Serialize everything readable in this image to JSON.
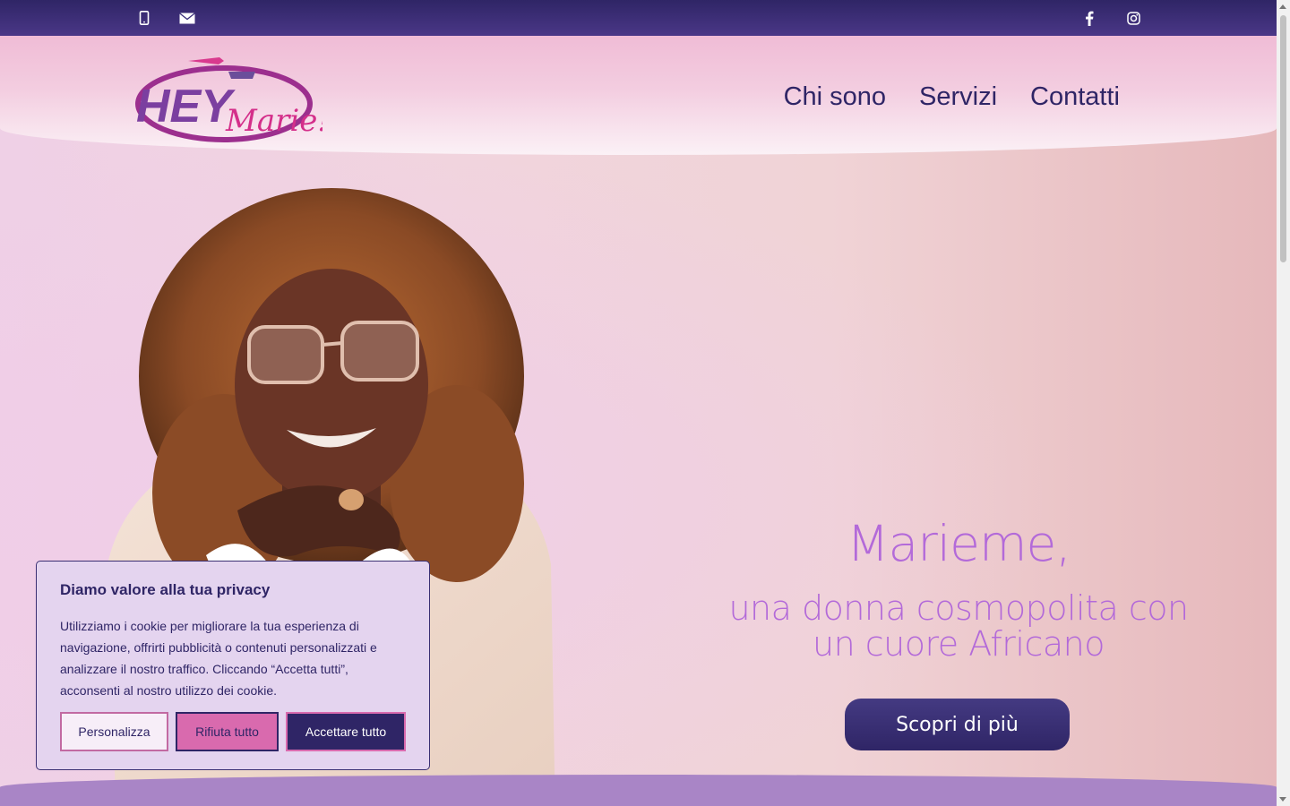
{
  "topbar": {
    "left_icons": [
      "mobile-phone-icon",
      "envelope-icon"
    ],
    "right_icons": [
      "facebook-icon",
      "instagram-icon"
    ]
  },
  "header": {
    "logo_text_1": "HEY",
    "logo_text_2": "Marie!",
    "nav": [
      "Chi sono",
      "Servizi",
      "Contatti"
    ]
  },
  "hero": {
    "title": "Marieme,",
    "subtitle": "una donna cosmopolita con un cuore Africano",
    "cta_label": "Scopri di più"
  },
  "cookie": {
    "title": "Diamo valore alla tua privacy",
    "body": "Utilizziamo i cookie per migliorare la tua esperienza di navigazione, offrirti pubblicità o contenuti personalizzati e analizzare il nostro traffico. Cliccando “Accetta tutti”, acconsenti al nostro utilizzo dei cookie.",
    "btn_customize": "Personalizza",
    "btn_reject": "Rifiuta tutto",
    "btn_accept": "Accettare tutto"
  },
  "colors": {
    "brand_dark": "#2f2566",
    "accent_purple": "#b36ad9",
    "accent_pink": "#d96aae"
  }
}
